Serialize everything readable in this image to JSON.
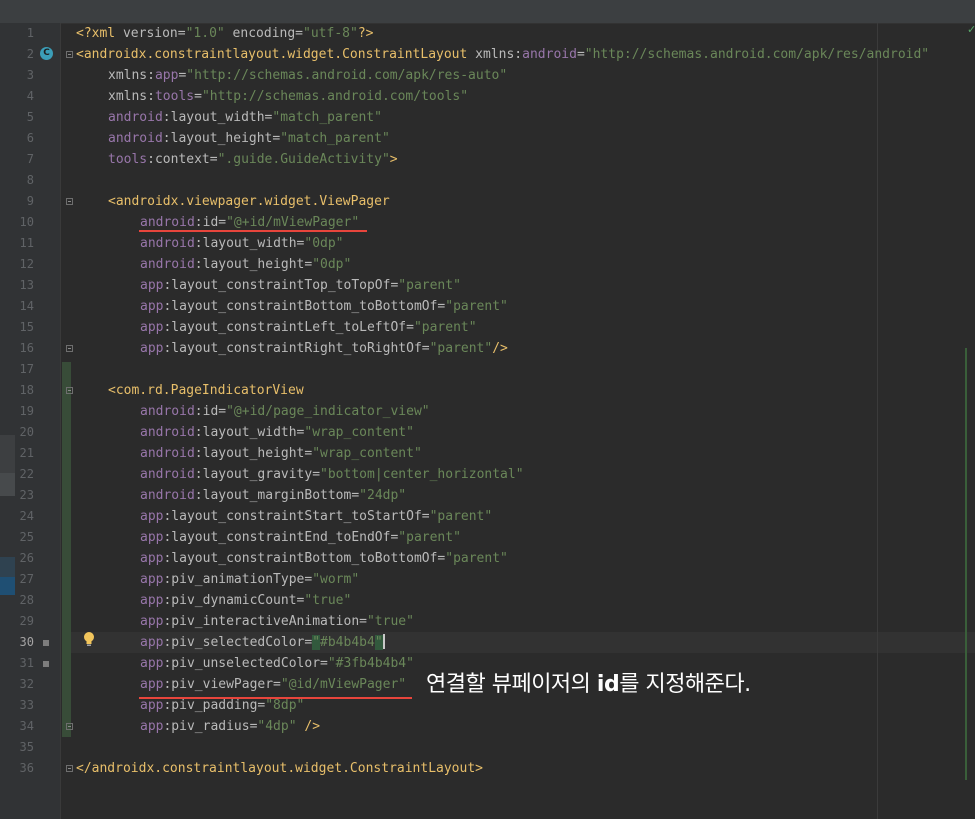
{
  "editor": {
    "active_line": 30,
    "annotation": {
      "before": "연결할 뷰페이저의 ",
      "bold": "id",
      "after": "를 지정해준다."
    },
    "icons": {
      "class_badge": "C",
      "inspection_status": "✓"
    },
    "colors": {
      "background": "#2b2b2b",
      "tag": "#e8bf6a",
      "namespace": "#9876aa",
      "attribute": "#bababa",
      "value": "#6a8759",
      "annotation_underline": "#e8453c"
    },
    "lines": [
      {
        "n": "1",
        "indent": 0,
        "tokens": [
          [
            "pi",
            "<?xml "
          ],
          [
            "attr",
            "version="
          ],
          [
            "val",
            "\"1.0\""
          ],
          [
            "attr",
            " encoding="
          ],
          [
            "val",
            "\"utf-8\""
          ],
          [
            "pi",
            "?>"
          ]
        ]
      },
      {
        "n": "2",
        "indent": 0,
        "tokens": [
          [
            "tag",
            "<androidx.constraintlayout.widget.ConstraintLayout "
          ],
          [
            "attr",
            "xmlns:"
          ],
          [
            "ns",
            "android"
          ],
          [
            "attr",
            "="
          ],
          [
            "val",
            "\"http://schemas.android.com/apk/res/android\""
          ]
        ]
      },
      {
        "n": "3",
        "indent": 1,
        "tokens": [
          [
            "attr",
            "xmlns:"
          ],
          [
            "ns",
            "app"
          ],
          [
            "attr",
            "="
          ],
          [
            "val",
            "\"http://schemas.android.com/apk/res-auto\""
          ]
        ]
      },
      {
        "n": "4",
        "indent": 1,
        "tokens": [
          [
            "attr",
            "xmlns:"
          ],
          [
            "ns",
            "tools"
          ],
          [
            "attr",
            "="
          ],
          [
            "val",
            "\"http://schemas.android.com/tools\""
          ]
        ]
      },
      {
        "n": "5",
        "indent": 1,
        "tokens": [
          [
            "ns",
            "android"
          ],
          [
            "attr",
            ":layout_width="
          ],
          [
            "val",
            "\"match_parent\""
          ]
        ]
      },
      {
        "n": "6",
        "indent": 1,
        "tokens": [
          [
            "ns",
            "android"
          ],
          [
            "attr",
            ":layout_height="
          ],
          [
            "val",
            "\"match_parent\""
          ]
        ]
      },
      {
        "n": "7",
        "indent": 1,
        "tokens": [
          [
            "ns",
            "tools"
          ],
          [
            "attr",
            ":context="
          ],
          [
            "val",
            "\".guide.GuideActivity\""
          ],
          [
            "tag",
            ">"
          ]
        ]
      },
      {
        "n": "8",
        "indent": 0,
        "tokens": []
      },
      {
        "n": "9",
        "indent": 1,
        "tokens": [
          [
            "tag",
            "<androidx.viewpager.widget.ViewPager"
          ]
        ]
      },
      {
        "n": "10",
        "indent": 2,
        "tokens": [
          [
            "ns",
            "android"
          ],
          [
            "attr",
            ":id="
          ],
          [
            "val",
            "\"@+id/mViewPager\""
          ]
        ]
      },
      {
        "n": "11",
        "indent": 2,
        "tokens": [
          [
            "ns",
            "android"
          ],
          [
            "attr",
            ":layout_width="
          ],
          [
            "val",
            "\"0dp\""
          ]
        ]
      },
      {
        "n": "12",
        "indent": 2,
        "tokens": [
          [
            "ns",
            "android"
          ],
          [
            "attr",
            ":layout_height="
          ],
          [
            "val",
            "\"0dp\""
          ]
        ]
      },
      {
        "n": "13",
        "indent": 2,
        "tokens": [
          [
            "ns",
            "app"
          ],
          [
            "attr",
            ":layout_constraintTop_toTopOf="
          ],
          [
            "val",
            "\"parent\""
          ]
        ]
      },
      {
        "n": "14",
        "indent": 2,
        "tokens": [
          [
            "ns",
            "app"
          ],
          [
            "attr",
            ":layout_constraintBottom_toBottomOf="
          ],
          [
            "val",
            "\"parent\""
          ]
        ]
      },
      {
        "n": "15",
        "indent": 2,
        "tokens": [
          [
            "ns",
            "app"
          ],
          [
            "attr",
            ":layout_constraintLeft_toLeftOf="
          ],
          [
            "val",
            "\"parent\""
          ]
        ]
      },
      {
        "n": "16",
        "indent": 2,
        "tokens": [
          [
            "ns",
            "app"
          ],
          [
            "attr",
            ":layout_constraintRight_toRightOf="
          ],
          [
            "val",
            "\"parent\""
          ],
          [
            "tag",
            "/>"
          ]
        ]
      },
      {
        "n": "17",
        "indent": 0,
        "tokens": []
      },
      {
        "n": "18",
        "indent": 1,
        "tokens": [
          [
            "tag",
            "<com.rd.PageIndicatorView"
          ]
        ]
      },
      {
        "n": "19",
        "indent": 2,
        "tokens": [
          [
            "ns",
            "android"
          ],
          [
            "attr",
            ":id="
          ],
          [
            "val",
            "\"@+id/page_indicator_view\""
          ]
        ]
      },
      {
        "n": "20",
        "indent": 2,
        "tokens": [
          [
            "ns",
            "android"
          ],
          [
            "attr",
            ":layout_width="
          ],
          [
            "val",
            "\"wrap_content\""
          ]
        ]
      },
      {
        "n": "21",
        "indent": 2,
        "tokens": [
          [
            "ns",
            "android"
          ],
          [
            "attr",
            ":layout_height="
          ],
          [
            "val",
            "\"wrap_content\""
          ]
        ]
      },
      {
        "n": "22",
        "indent": 2,
        "tokens": [
          [
            "ns",
            "android"
          ],
          [
            "attr",
            ":layout_gravity="
          ],
          [
            "val",
            "\"bottom|center_horizontal\""
          ]
        ]
      },
      {
        "n": "23",
        "indent": 2,
        "tokens": [
          [
            "ns",
            "android"
          ],
          [
            "attr",
            ":layout_marginBottom="
          ],
          [
            "val",
            "\"24dp\""
          ]
        ]
      },
      {
        "n": "24",
        "indent": 2,
        "tokens": [
          [
            "ns",
            "app"
          ],
          [
            "attr",
            ":layout_constraintStart_toStartOf="
          ],
          [
            "val",
            "\"parent\""
          ]
        ]
      },
      {
        "n": "25",
        "indent": 2,
        "tokens": [
          [
            "ns",
            "app"
          ],
          [
            "attr",
            ":layout_constraintEnd_toEndOf="
          ],
          [
            "val",
            "\"parent\""
          ]
        ]
      },
      {
        "n": "26",
        "indent": 2,
        "tokens": [
          [
            "ns",
            "app"
          ],
          [
            "attr",
            ":layout_constraintBottom_toBottomOf="
          ],
          [
            "val",
            "\"parent\""
          ]
        ]
      },
      {
        "n": "27",
        "indent": 2,
        "tokens": [
          [
            "ns",
            "app"
          ],
          [
            "attr",
            ":piv_animationType="
          ],
          [
            "val",
            "\"worm\""
          ]
        ]
      },
      {
        "n": "28",
        "indent": 2,
        "tokens": [
          [
            "ns",
            "app"
          ],
          [
            "attr",
            ":piv_dynamicCount="
          ],
          [
            "val",
            "\"true\""
          ]
        ]
      },
      {
        "n": "29",
        "indent": 2,
        "tokens": [
          [
            "ns",
            "app"
          ],
          [
            "attr",
            ":piv_interactiveAnimation="
          ],
          [
            "val",
            "\"true\""
          ]
        ]
      },
      {
        "n": "30",
        "indent": 2,
        "tokens": [
          [
            "ns",
            "app"
          ],
          [
            "attr",
            ":piv_selectedColor="
          ],
          [
            "hl",
            "\""
          ],
          [
            "val",
            "#b4b4b4"
          ],
          [
            "hl",
            "\""
          ],
          [
            "cursor",
            ""
          ]
        ]
      },
      {
        "n": "31",
        "indent": 2,
        "tokens": [
          [
            "ns",
            "app"
          ],
          [
            "attr",
            ":piv_unselectedColor="
          ],
          [
            "val",
            "\"#3fb4b4b4\""
          ]
        ]
      },
      {
        "n": "32",
        "indent": 2,
        "tokens": [
          [
            "ns",
            "app"
          ],
          [
            "attr",
            ":piv_viewPager="
          ],
          [
            "val",
            "\"@id/mViewPager\""
          ]
        ]
      },
      {
        "n": "33",
        "indent": 2,
        "tokens": [
          [
            "ns",
            "app"
          ],
          [
            "attr",
            ":piv_padding="
          ],
          [
            "val",
            "\"8dp\""
          ]
        ]
      },
      {
        "n": "34",
        "indent": 2,
        "tokens": [
          [
            "ns",
            "app"
          ],
          [
            "attr",
            ":piv_radius="
          ],
          [
            "val",
            "\"4dp\""
          ],
          [
            "tag",
            " />"
          ]
        ]
      },
      {
        "n": "35",
        "indent": 0,
        "tokens": []
      },
      {
        "n": "36",
        "indent": 0,
        "tokens": [
          [
            "tag",
            "</androidx.constraintlayout.widget.ConstraintLayout>"
          ]
        ]
      }
    ]
  }
}
